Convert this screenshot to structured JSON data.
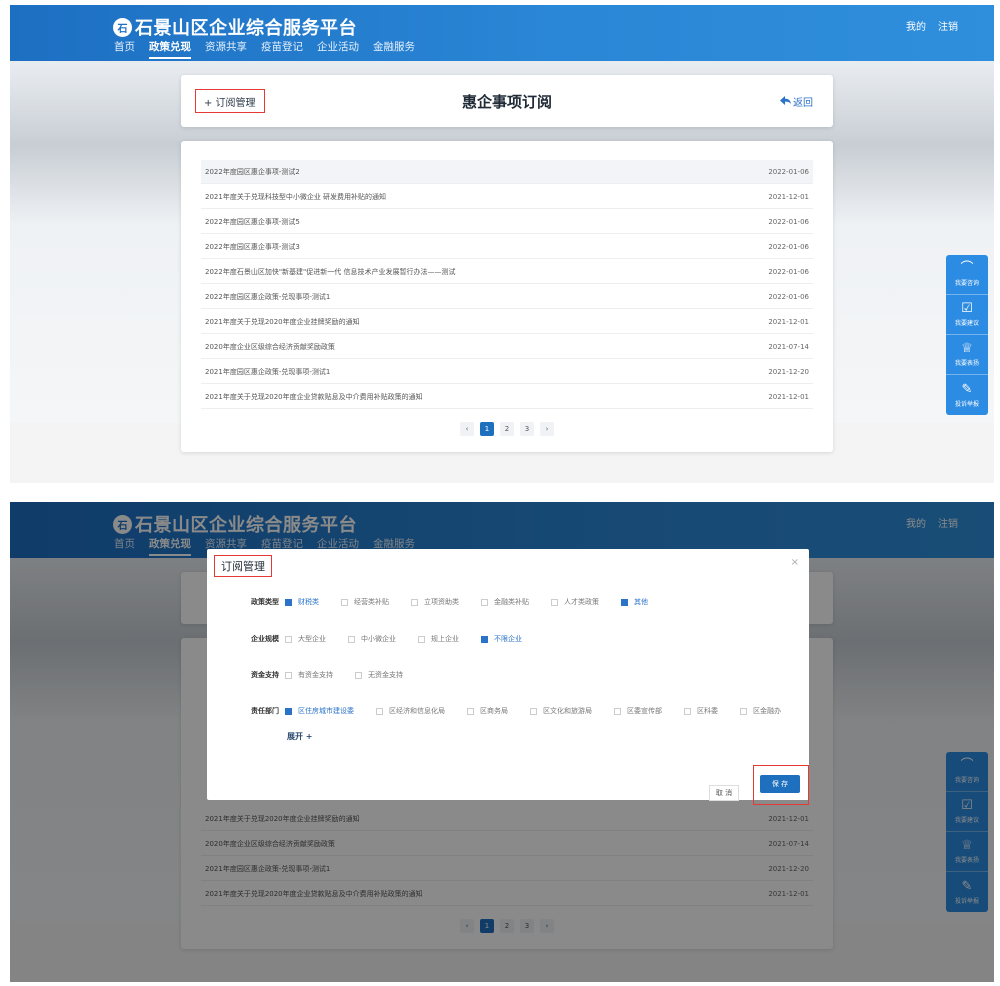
{
  "site": {
    "logo_mark": "石",
    "title": "石景山区企业综合服务平台",
    "nav": [
      "首页",
      "政策兑现",
      "资源共享",
      "疫苗登记",
      "企业活动",
      "金融服务"
    ],
    "user_links": [
      "我的",
      "注销"
    ]
  },
  "page": {
    "subscribe_button": "+ 订阅管理",
    "title": "惠企事项订阅",
    "back_label": "返回"
  },
  "list": [
    {
      "title": "2022年度园区惠企事项-测试2",
      "date": "2022-01-06"
    },
    {
      "title": "2021年度关于兑现科技型中小微企业 研发费用补贴的通知",
      "date": "2021-12-01"
    },
    {
      "title": "2022年度园区惠企事项-测试5",
      "date": "2022-01-06"
    },
    {
      "title": "2022年度园区惠企事项-测试3",
      "date": "2022-01-06"
    },
    {
      "title": "2022年度石景山区加快\"新基建\"促进新一代 信息技术产业发展暂行办法——测试",
      "date": "2022-01-06"
    },
    {
      "title": "2022年度园区惠企政策-兑现事项-测试1",
      "date": "2022-01-06"
    },
    {
      "title": "2021年度关于兑现2020年度企业挂牌奖励的通知",
      "date": "2021-12-01"
    },
    {
      "title": "2020年度企业区级综合经济贡献奖励政策",
      "date": "2021-07-14"
    },
    {
      "title": "2021年度园区惠企政策-兑现事项-测试1",
      "date": "2021-12-20"
    },
    {
      "title": "2021年度关于兑现2020年度企业贷款贴息及中介费用补贴政策的通知",
      "date": "2021-12-01"
    }
  ],
  "pagination": {
    "prev": "‹",
    "pages": [
      "1",
      "2",
      "3"
    ],
    "current": "1",
    "next": "›"
  },
  "side_panel": [
    {
      "icon": "headset-icon",
      "glyph": "⌒",
      "label": "我要咨询"
    },
    {
      "icon": "edit-icon",
      "glyph": "☑",
      "label": "我要建议"
    },
    {
      "icon": "award-icon",
      "glyph": "♕",
      "label": "我要表扬"
    },
    {
      "icon": "report-icon",
      "glyph": "✎",
      "label": "投诉举报"
    }
  ],
  "modal": {
    "title": "订阅管理",
    "close": "×",
    "policy_type": {
      "label": "政策类型",
      "options": [
        {
          "label": "财税类",
          "checked": true
        },
        {
          "label": "经营类补贴",
          "checked": false
        },
        {
          "label": "立项资助类",
          "checked": false
        },
        {
          "label": "金融类补贴",
          "checked": false
        },
        {
          "label": "人才类政策",
          "checked": false
        },
        {
          "label": "其他",
          "checked": true
        }
      ]
    },
    "enterprise_scale": {
      "label": "企业规模",
      "options": [
        {
          "label": "大型企业",
          "checked": false
        },
        {
          "label": "中小微企业",
          "checked": false
        },
        {
          "label": "规上企业",
          "checked": false
        },
        {
          "label": "不限企业",
          "checked": true
        }
      ]
    },
    "funding": {
      "label": "资金支持",
      "options": [
        {
          "label": "有资金支持",
          "checked": false
        },
        {
          "label": "无资金支持",
          "checked": false
        }
      ]
    },
    "department": {
      "label": "责任部门",
      "options": [
        {
          "label": "区住房城市建设委",
          "checked": true
        },
        {
          "label": "区经济和信息化局",
          "checked": false
        },
        {
          "label": "区商务局",
          "checked": false
        },
        {
          "label": "区文化和旅游局",
          "checked": false
        },
        {
          "label": "区委宣传部",
          "checked": false
        },
        {
          "label": "区科委",
          "checked": false
        },
        {
          "label": "区金融办",
          "checked": false
        }
      ]
    },
    "expand": "展开 +",
    "cancel": "取 消",
    "save": "保 存"
  },
  "colors": {
    "brand_blue": "#1f6fbf",
    "accent": "#2a73c8",
    "highlight_red": "#e53935",
    "side_panel": "#2c8be2"
  }
}
